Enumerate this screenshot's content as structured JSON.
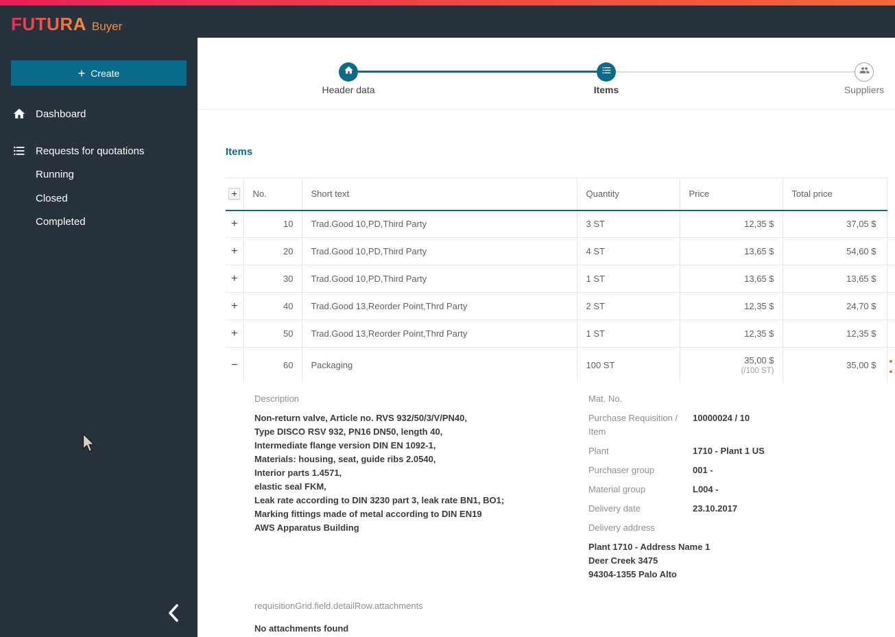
{
  "brand": {
    "name": "FUTURA",
    "suffix": "Buyer"
  },
  "sidebar": {
    "create_button": {
      "icon": "+",
      "label": "Create"
    },
    "nav": [
      {
        "label": "Dashboard"
      },
      {
        "label": "Requests for quotations"
      }
    ],
    "sub_nav": [
      {
        "label": "Running"
      },
      {
        "label": "Closed"
      },
      {
        "label": "Completed"
      }
    ]
  },
  "stepper": {
    "steps": [
      {
        "label": "Header data",
        "state": "done"
      },
      {
        "label": "Items",
        "state": "active"
      },
      {
        "label": "Suppliers",
        "state": "upcoming"
      }
    ]
  },
  "items": {
    "title": "Items",
    "table": {
      "add_button": "+",
      "headers": {
        "no": "No.",
        "short_text": "Short text",
        "quantity": "Quantity",
        "price": "Price",
        "total_price": "Total price"
      },
      "rows": [
        {
          "expander": "+",
          "no": "10",
          "short_text": "Trad.Good 10,PD,Third Party",
          "quantity": "3 ST",
          "price": "12,35 $",
          "total": "37,05 $"
        },
        {
          "expander": "+",
          "no": "20",
          "short_text": "Trad.Good 10,PD,Third Party",
          "quantity": "4 ST",
          "price": "13,65 $",
          "total": "54,60 $"
        },
        {
          "expander": "+",
          "no": "30",
          "short_text": "Trad.Good 10,PD,Third Party",
          "quantity": "1 ST",
          "price": "13,65 $",
          "total": "13,65 $"
        },
        {
          "expander": "+",
          "no": "40",
          "short_text": "Trad.Good 13,Reorder Point,Thrd Party",
          "quantity": "2 ST",
          "price": "12,35 $",
          "total": "24,70 $"
        },
        {
          "expander": "+",
          "no": "50",
          "short_text": "Trad.Good 13,Reorder Point,Thrd Party",
          "quantity": "1 ST",
          "price": "12,35 $",
          "total": "12,35 $"
        },
        {
          "expander": "−",
          "no": "60",
          "short_text": "Packaging",
          "quantity": "100 ST",
          "price": "35,00 $",
          "price_unit": "(/100 ST)",
          "total": "35,00 $"
        }
      ]
    },
    "detail": {
      "description_label": "Description",
      "description_lines": [
        "Non-return valve, Article no. RVS 932/50/3/V/PN40,",
        "Type DISCO RSV 932, PN16 DN50, length 40,",
        "Intermediate flange version DIN EN 1092-1,",
        "Materials: housing, seat, guide ribs 2.0540,",
        "Interior parts 1.4571,",
        "elastic seal FKM,",
        "Leak rate according to DIN 3230 part 3, leak rate BN1, BO1;",
        "Marking fittings made of metal according to DIN EN19",
        "AWS Apparatus Building"
      ],
      "fields": [
        {
          "label": "Mat. No.",
          "value": ""
        },
        {
          "label": "Purchase Requisition / Item",
          "value": "10000024 / 10"
        },
        {
          "label": "Plant",
          "value": "1710 - Plant 1 US"
        },
        {
          "label": "Purchaser group",
          "value": "001 -"
        },
        {
          "label": "Material group",
          "value": "L004 -"
        },
        {
          "label": "Delivery date",
          "value": "23.10.2017"
        }
      ],
      "delivery_address_label": "Delivery address",
      "delivery_address_lines": [
        "Plant 1710 - Address Name 1",
        "Deer Creek 3475",
        "94304-1355 Palo Alto"
      ],
      "attachments_label": "requisitionGrid.field.detailRow.attachments",
      "attachments_empty": "No attachments found"
    }
  },
  "colors": {
    "accent_teal": "#0a6b8a",
    "sidebar_bg": "#28323c",
    "topbar_gradient_start": "#ec1e5a",
    "topbar_gradient_end": "#f2683a",
    "brand_gradient_start": "#ed2b56",
    "brand_gradient_end": "#f2913c",
    "suffix_orange": "#f2913c"
  }
}
